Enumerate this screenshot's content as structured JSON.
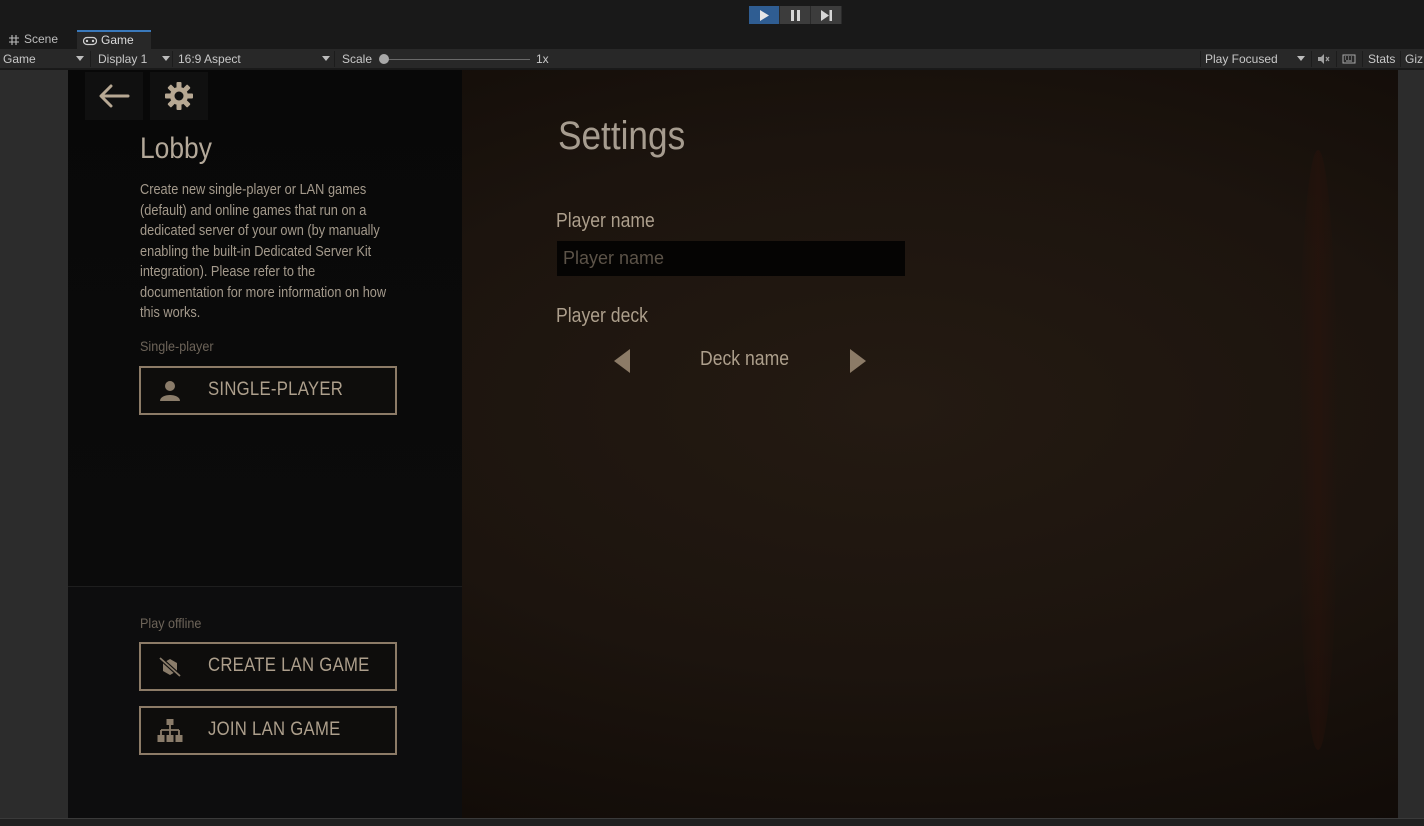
{
  "editor": {
    "play_controls": [
      {
        "name": "play",
        "icon": "play-icon",
        "active": true
      },
      {
        "name": "pause",
        "icon": "pause-icon",
        "active": false
      },
      {
        "name": "step",
        "icon": "step-icon",
        "active": false
      }
    ],
    "tabs": [
      {
        "label": "Scene",
        "icon": "grid-icon",
        "active": false
      },
      {
        "label": "Game",
        "icon": "gamepad-icon",
        "active": true
      }
    ],
    "game_toolbar": {
      "view_mode": "Game",
      "display": "Display 1",
      "aspect": "16:9 Aspect",
      "scale_label": "Scale",
      "scale_value": "1x",
      "play_mode": "Play Focused",
      "stats_label": "Stats",
      "gizmos_label": "Giz"
    }
  },
  "game": {
    "top_icons": [
      {
        "name": "back",
        "icon": "arrow-left-icon"
      },
      {
        "name": "settings",
        "icon": "gear-icon"
      }
    ],
    "lobby": {
      "title": "Lobby",
      "description": "Create new single-player or LAN games (default) and online games that run on a dedicated server of your own (by manually enabling the built-in Dedicated Server Kit integration). Please refer to the documentation for more information on how this works.",
      "single_player_label": "Single-player",
      "single_player_button": "SINGLE-PLAYER",
      "play_offline_label": "Play offline",
      "create_lan_button": "CREATE LAN GAME",
      "join_lan_button": "JOIN LAN GAME"
    },
    "settings": {
      "title": "Settings",
      "player_name_label": "Player name",
      "player_name_value": "",
      "player_name_placeholder": "Player name",
      "player_deck_label": "Player deck",
      "deck_name": "Deck name"
    }
  },
  "colors": {
    "accent_blue": "#2f5d92",
    "button_border": "#8c7b67",
    "text_warm": "#ad9f8c"
  }
}
